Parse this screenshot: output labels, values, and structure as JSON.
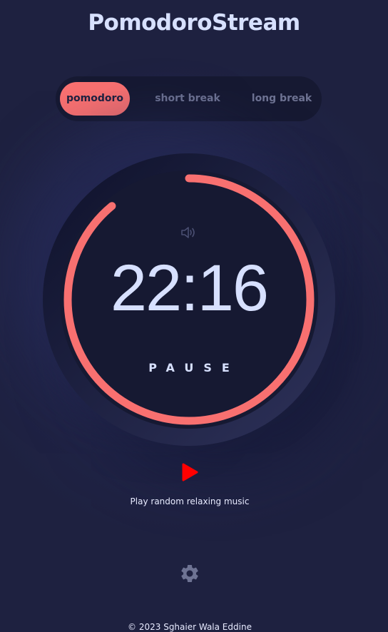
{
  "app": {
    "title": "PomodoroStream"
  },
  "modes": {
    "items": [
      {
        "label": "pomodoro",
        "active": true
      },
      {
        "label": "short break",
        "active": false
      },
      {
        "label": "long break",
        "active": false
      }
    ]
  },
  "timer": {
    "time": "22:16",
    "action_label": "PAUSE",
    "progress_fraction": 0.89,
    "sound_icon": "speaker-icon"
  },
  "music": {
    "play_icon": "play-icon",
    "label": "Play random relaxing music"
  },
  "settings": {
    "icon": "gear-icon"
  },
  "footer": {
    "text": "© 2023 Sghaier Wala Eddine"
  },
  "colors": {
    "accent": "#f87070",
    "background": "#1e2140",
    "panel": "#161932",
    "text": "#d7e0ff",
    "inactive_text": "#6e7393",
    "play": "#ff0000"
  }
}
